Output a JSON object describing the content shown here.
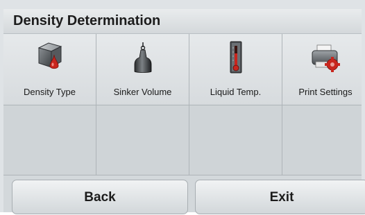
{
  "header": {
    "title": "Density Determination"
  },
  "menu": {
    "items": [
      {
        "label": "Density Type",
        "icon": "density-type-icon"
      },
      {
        "label": "Sinker Volume",
        "icon": "sinker-weight-icon"
      },
      {
        "label": "Liquid Temp.",
        "icon": "thermometer-icon"
      },
      {
        "label": "Print Settings",
        "icon": "printer-settings-icon"
      }
    ]
  },
  "footer": {
    "back_label": "Back",
    "exit_label": "Exit"
  },
  "colors": {
    "accent_red": "#c8261e",
    "background": "#dfe3e6"
  }
}
